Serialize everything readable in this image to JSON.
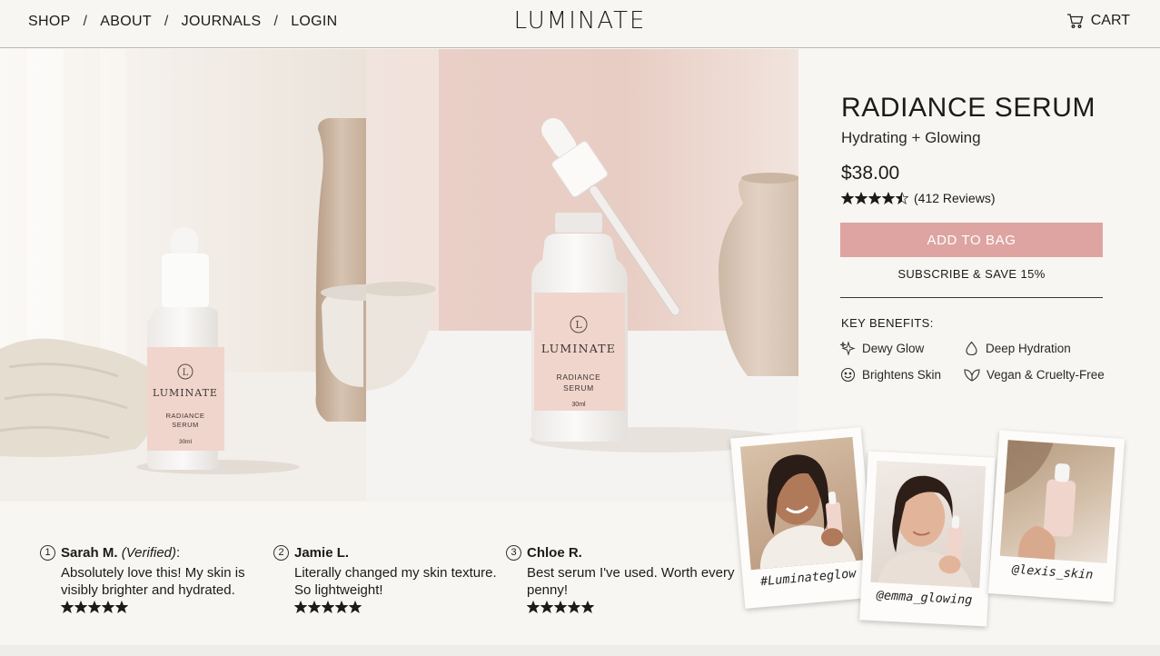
{
  "nav": {
    "links": [
      "SHOP",
      "ABOUT",
      "JOURNALS",
      "LOGIN"
    ],
    "separator": "/",
    "brand": "LUMINATE",
    "cart_label": "CART"
  },
  "product": {
    "title": "RADIANCE SERUM",
    "subtitle": "Hydrating + Glowing",
    "price": "$38.00",
    "rating": 4.5,
    "reviews_label": "(412 Reviews)",
    "add_to_bag": "ADD TO BAG",
    "subscribe": "SUBSCRIBE & SAVE 15%",
    "benefits_title": "KEY BENEFITS:",
    "benefits": [
      {
        "label": "Dewy Glow",
        "icon": "sparkle-icon"
      },
      {
        "label": "Deep Hydration",
        "icon": "droplet-icon"
      },
      {
        "label": "Brightens Skin",
        "icon": "smile-icon"
      },
      {
        "label": "Vegan & Cruelty-Free",
        "icon": "leaf-icon"
      }
    ]
  },
  "bottle": {
    "brand": "LUMINATE",
    "monogram": "L",
    "name_line1": "RADIANCE",
    "name_line2": "SERUM",
    "volume": "30ml"
  },
  "reviews": [
    {
      "number": "1",
      "name": "Sarah M.",
      "verified": "(Verified)",
      "after_name": ":",
      "text": "Absolutely love this! My skin is visibly brighter and hydrated.",
      "stars": 5
    },
    {
      "number": "2",
      "name": "Jamie L.",
      "verified": "",
      "after_name": "",
      "text": "Literally changed my skin texture. So lightweight!",
      "stars": 5
    },
    {
      "number": "3",
      "name": "Chloe R.",
      "verified": "",
      "after_name": "",
      "text": "Best serum I've used. Worth every penny!",
      "stars": 5
    }
  ],
  "ugc": [
    {
      "caption": "#Luminateglow"
    },
    {
      "caption": "@emma_glowing"
    },
    {
      "caption": "@lexis_skin"
    }
  ],
  "colors": {
    "accent_pink": "#dea4a2",
    "label_pink": "#f0d5cd",
    "background": "#f8f6f2",
    "text": "#1d1b1a"
  }
}
